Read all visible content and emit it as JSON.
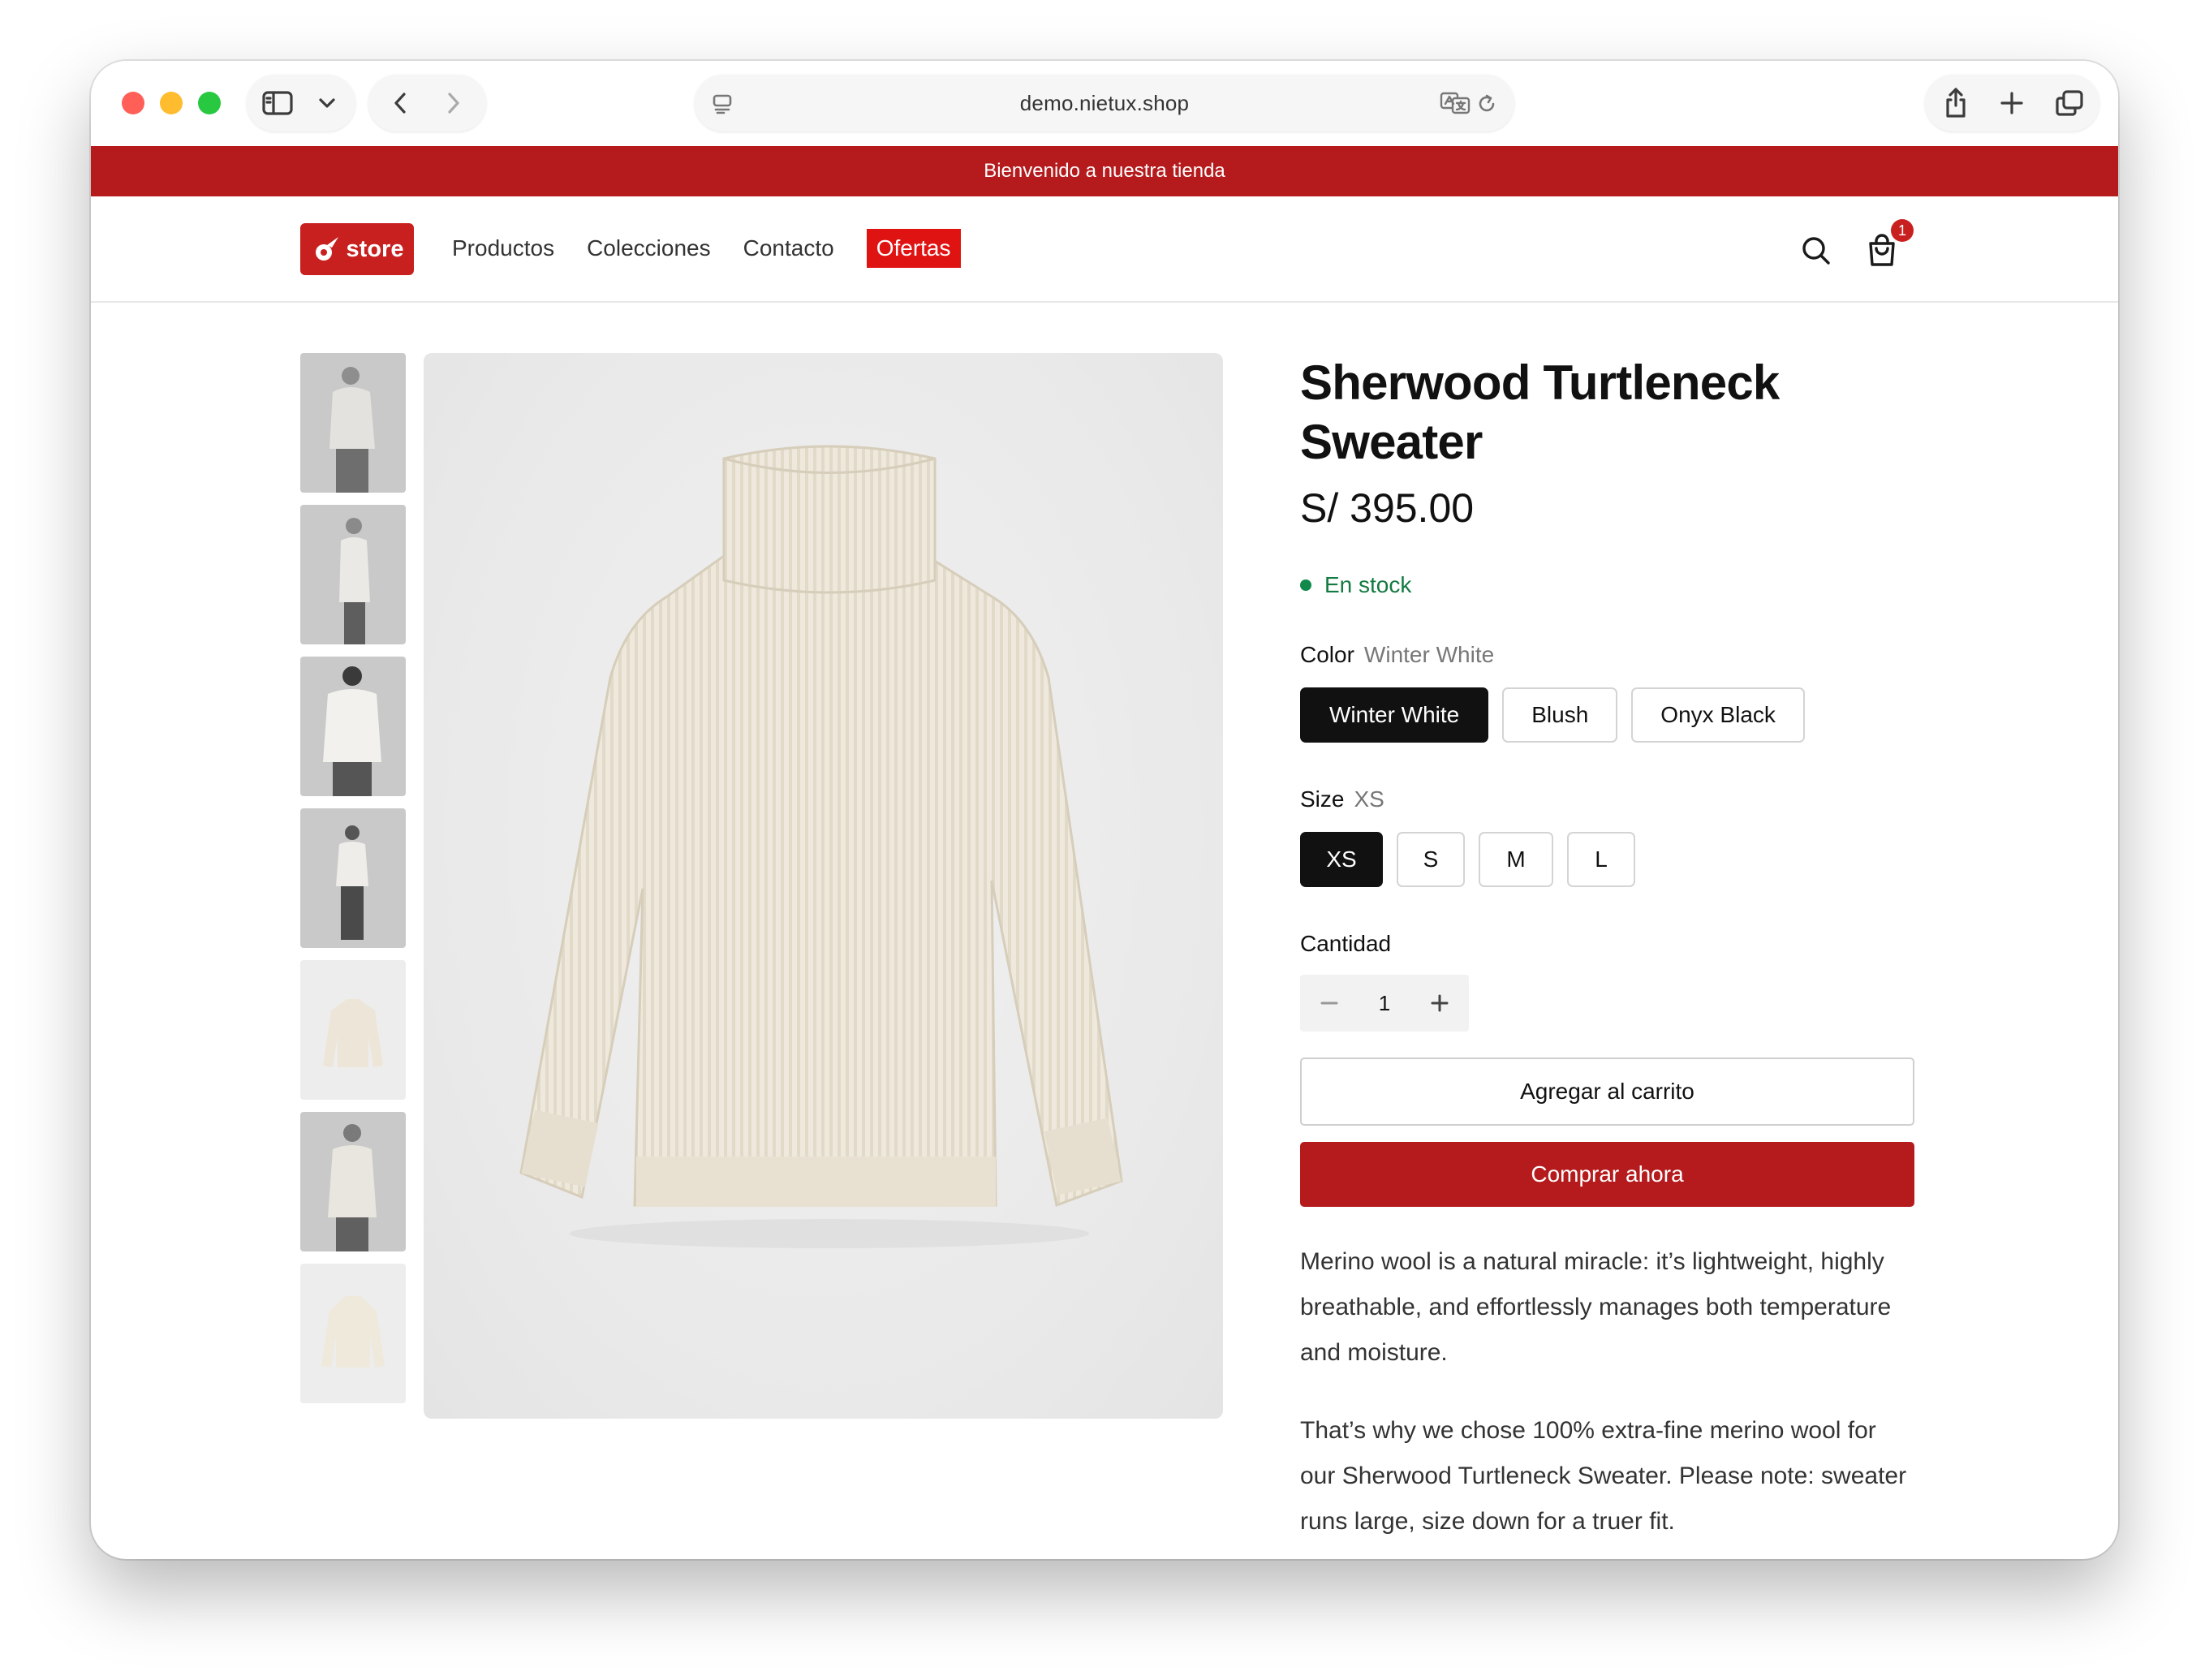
{
  "browser": {
    "url": "demo.nietux.shop"
  },
  "announcement": "Bienvenido a nuestra tienda",
  "header": {
    "logo_text": "store",
    "nav": [
      "Productos",
      "Colecciones",
      "Contacto",
      "Ofertas"
    ],
    "cart_count": "1"
  },
  "product": {
    "title_line1": "Sherwood Turtleneck",
    "title_line2": "Sweater",
    "price": "S/ 395.00",
    "stock": "En stock",
    "color_label": "Color",
    "color_selected": "Winter White",
    "colors": [
      "Winter White",
      "Blush",
      "Onyx Black"
    ],
    "size_label": "Size",
    "size_selected": "XS",
    "sizes": [
      "XS",
      "S",
      "M",
      "L"
    ],
    "quantity_label": "Cantidad",
    "quantity": "1",
    "add_to_cart": "Agregar al carrito",
    "buy_now": "Comprar ahora",
    "description": [
      "Merino wool is a natural miracle: it’s lightweight, highly breathable, and effortlessly manages both temperature and moisture.",
      "That’s why we chose 100% extra-fine merino wool for our Sherwood Turtleneck Sweater. Please note: sweater runs large, size down for a truer fit."
    ]
  },
  "colors": {
    "brand_red": "#b51b1d",
    "offer_red": "#e01313",
    "stock_green": "#137a42",
    "selected_dark": "#111111"
  },
  "icons": {
    "sidebar": "sidebar-icon",
    "back": "chevron-left-icon",
    "forward": "chevron-right-icon",
    "translate": "translate-icon",
    "reload": "reload-icon",
    "share": "share-icon",
    "new_tab": "plus-icon",
    "tabs": "tabs-overview-icon",
    "search": "search-icon",
    "cart": "shopping-bag-icon"
  }
}
